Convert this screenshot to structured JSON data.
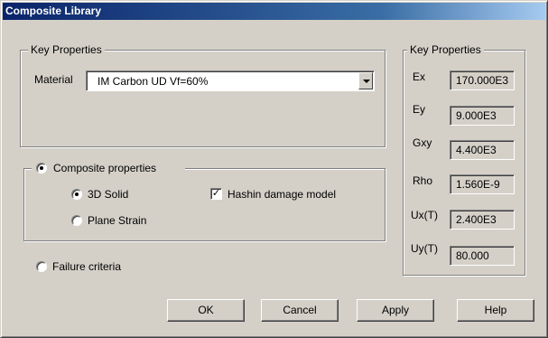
{
  "window": {
    "title": "Composite Library"
  },
  "key_properties_group": {
    "legend": "Key Properties",
    "material_label": "Material",
    "material_value": "IM Carbon UD Vf=60%"
  },
  "key_properties_panel": {
    "legend": "Key Properties",
    "rows": [
      {
        "label": "Ex",
        "value": "170.000E3"
      },
      {
        "label": "Ey",
        "value": "9.000E3"
      },
      {
        "label": "Gxy",
        "value": "4.400E3"
      },
      {
        "label": "Rho",
        "value": "1.560E-9"
      },
      {
        "label": "Ux(T)",
        "value": "2.400E3"
      },
      {
        "label": "Uy(T)",
        "value": "80.000"
      }
    ]
  },
  "composite_group": {
    "legend": "Composite properties",
    "selected": true,
    "solid_label": "3D Solid",
    "solid_selected": true,
    "plane_label": "Plane Strain",
    "plane_selected": false,
    "hashin_label": "Hashin damage model",
    "hashin_checked": true
  },
  "failure": {
    "label": "Failure criteria",
    "selected": false
  },
  "buttons": {
    "ok": "OK",
    "cancel": "Cancel",
    "apply": "Apply",
    "help": "Help"
  },
  "colors": {
    "face": "#d4d0c8",
    "title_start": "#0a246a",
    "title_end": "#a6caf0"
  },
  "icons": {
    "check": "checkmark-icon",
    "dropdown": "chevron-down-icon"
  }
}
